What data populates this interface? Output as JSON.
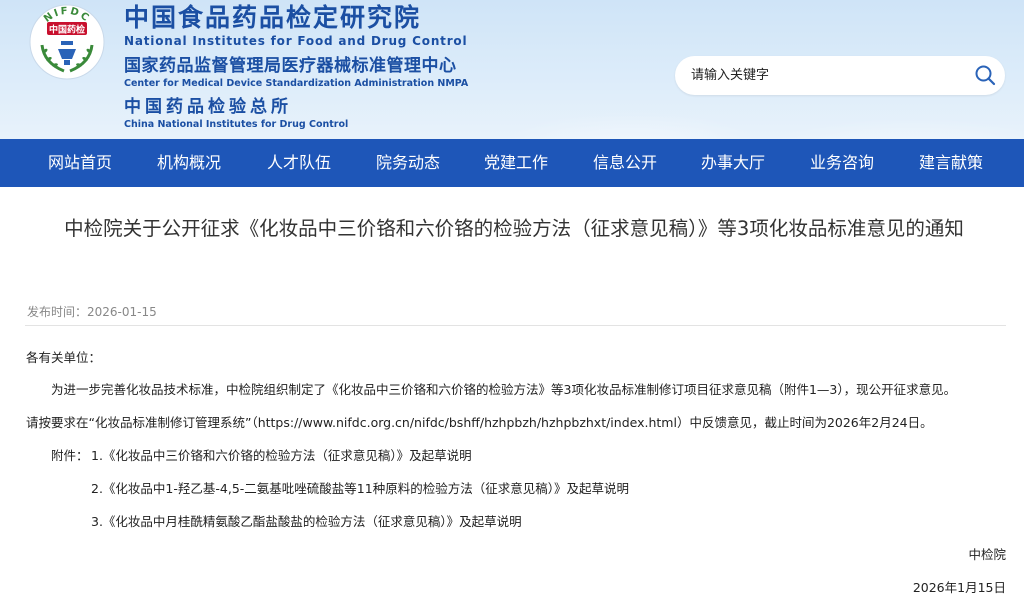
{
  "header": {
    "logo": {
      "badge_text": "中国药检",
      "arc_text": "NIFDC"
    },
    "org_zh_1": "中国食品药品检定研究院",
    "org_en_1": "National Institutes for Food and Drug Control",
    "org_zh_2": "国家药品监督管理局医疗器械标准管理中心",
    "org_en_2": "Center for Medical Device Standardization Administration NMPA",
    "org_zh_3": "中国药品检验总所",
    "org_en_3": "China National Institutes for Drug Control",
    "search": {
      "placeholder": "请输入关键字",
      "icon": "search-icon"
    },
    "colors": {
      "brand_blue": "#1b4fa3",
      "nav_blue": "#1e56b8",
      "logo_green": "#3a8a3a",
      "logo_red": "#c8102e"
    }
  },
  "nav": {
    "items": [
      "网站首页",
      "机构概况",
      "人才队伍",
      "院务动态",
      "党建工作",
      "信息公开",
      "办事大厅",
      "业务咨询",
      "建言献策"
    ]
  },
  "article": {
    "title": "中检院关于公开征求《化妆品中三价铬和六价铬的检验方法（征求意见稿）》等3项化妆品标准意见的通知",
    "date_label": "发布时间：",
    "date_value": "2026-01-15",
    "salutation": "各有关单位：",
    "para1": "为进一步完善化妆品技术标准，中检院组织制定了《化妆品中三价铬和六价铬的检验方法》等3项化妆品标准制修订项目征求意见稿（附件1—3），现公开征求意见。",
    "para2": "请按要求在“化妆品标准制修订管理系统”（https://www.nifdc.org.cn/nifdc/bshff/hzhpbzh/hzhpbzhxt/index.html）中反馈意见，截止时间为2026年2月24日。",
    "attachments_label": "附件：",
    "attachments": [
      "1.《化妆品中三价铬和六价铬的检验方法（征求意见稿）》及起草说明",
      "2.《化妆品中1-羟乙基-4,5-二氨基吡唑硫酸盐等11种原料的检验方法（征求意见稿）》及起草说明",
      "3.《化妆品中月桂酰精氨酸乙酯盐酸盐的检验方法（征求意见稿）》及起草说明"
    ],
    "signature": "中检院",
    "sign_date": "2026年1月15日"
  }
}
